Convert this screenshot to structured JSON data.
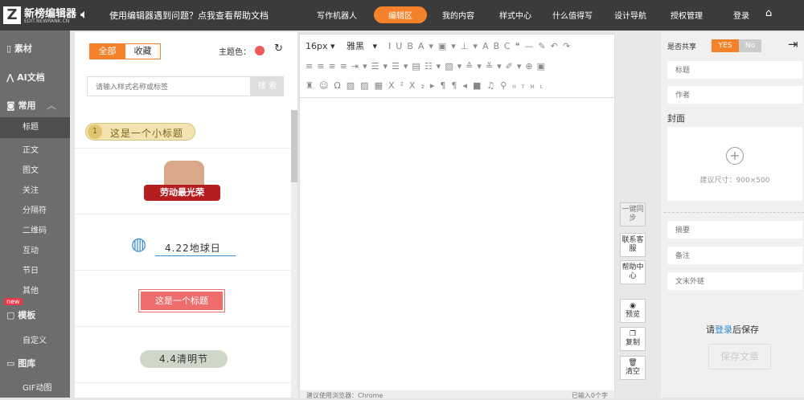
{
  "header": {
    "logo": "新榜编辑器",
    "logo_sub": "EDIT.NEWRANK.CN",
    "notice": "使用编辑器遇到问题？点我查看帮助文档",
    "nav": [
      "写作机器人",
      "编辑区",
      "我的内容",
      "样式中心",
      "什么值得写",
      "设计导航",
      "授权管理",
      "登录"
    ]
  },
  "sidebar": {
    "items": [
      {
        "label": "素材",
        "icon": "book-icon"
      },
      {
        "label": "AI文档",
        "icon": "ai-icon"
      },
      {
        "label": "常用",
        "icon": "cube-icon"
      },
      {
        "label": "标题"
      },
      {
        "label": "正文"
      },
      {
        "label": "图文"
      },
      {
        "label": "关注"
      },
      {
        "label": "分隔符"
      },
      {
        "label": "二维码"
      },
      {
        "label": "互动"
      },
      {
        "label": "节日"
      },
      {
        "label": "其他"
      },
      {
        "label": "模板",
        "badge": "new"
      },
      {
        "label": "自定义"
      },
      {
        "label": "图库"
      },
      {
        "label": "GIF动图"
      }
    ]
  },
  "styles": {
    "tab_all": "全部",
    "tab_fav": "收藏",
    "theme_label": "主题色：",
    "theme_color": "#f25a5a",
    "search_placeholder": "请输入样式名称或标签",
    "search_btn": "搜 索",
    "items": [
      "这是一个小标题",
      "劳动最光荣",
      "4.22地球日",
      "这是一个标题",
      "4.4清明节"
    ],
    "item_num": "1"
  },
  "editor": {
    "font_size": "16px",
    "font_family": "雅黑",
    "status_left": "建议使用浏览器：Chrome",
    "status_right": "已输入0个字"
  },
  "middle": {
    "sync": "一键同步",
    "service": "联系客服",
    "help": "帮助中心",
    "preview": "预览",
    "copy": "复制",
    "clear": "清空"
  },
  "right": {
    "share_label": "是否共享",
    "yes": "YES",
    "no": "No",
    "title_ph": "标题",
    "author_ph": "作者",
    "cover_label": "封面",
    "cover_hint": "建议尺寸：900×500",
    "summary_ph": "摘要",
    "note_ph": "备注",
    "link_ph": "文末外链",
    "login_prompt_pre": "请",
    "login_link": "登录",
    "login_prompt_post": "后保存",
    "save_btn": "保存文章"
  }
}
